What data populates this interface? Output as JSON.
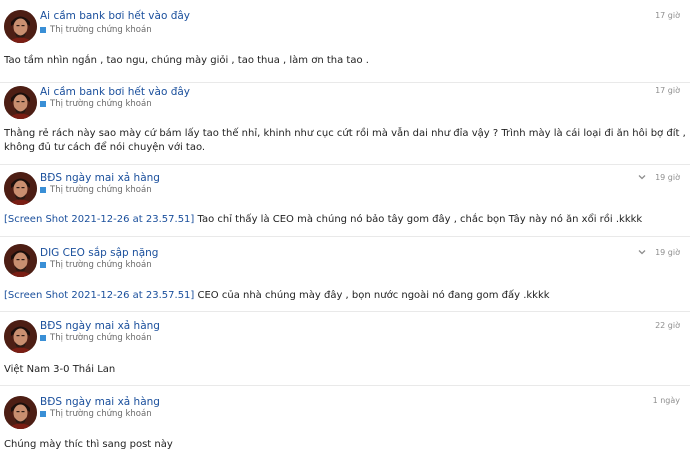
{
  "posts": [
    {
      "username": "Ai cầm bank bơi hết vào đây",
      "category": "Thị trường chứng khoán",
      "time": "17 giờ",
      "expandable": false,
      "link": "",
      "text": "Tao tầm nhìn ngắn , tao ngu, chúng mày giỏi , tao thua , làm ơn tha tao ."
    },
    {
      "username": "Ai cầm bank bơi hết vào đây",
      "category": "Thị trường chứng khoán",
      "time": "17 giờ",
      "expandable": false,
      "link": "",
      "text": "Thằng rẻ rách này sao mày cứ bám lấy tao thế nhỉ, khinh như cục cứt rồi mà vẫn dai như đỉa vậy ? Trình mày là cái loại đi ăn hôi bợ đít , không đủ tư cách để nói chuyện với tao."
    },
    {
      "username": "BĐS ngày mai xả hàng",
      "category": "Thị trường chứng khoán",
      "time": "19 giờ",
      "expandable": true,
      "link": "[Screen Shot 2021-12-26 at 23.57.51]",
      "text": " Tao chỉ thấy là CEO mà chúng nó bảo tây gom đây , chắc bọn Tây này nó ăn xổi rồi .kkkk"
    },
    {
      "username": "DIG CEO sắp sập nặng",
      "category": "Thị trường chứng khoán",
      "time": "19 giờ",
      "expandable": true,
      "link": "[Screen Shot 2021-12-26 at 23.57.51]",
      "text": " CEO của nhà chúng mày đây , bọn nước ngoài nó đang gom đấy .kkkk"
    },
    {
      "username": "BĐS ngày mai xả hàng",
      "category": "Thị trường chứng khoán",
      "time": "22 giờ",
      "expandable": false,
      "link": "",
      "text": "Việt Nam 3-0 Thái Lan"
    },
    {
      "username": "BĐS ngày mai xả hàng",
      "category": "Thị trường chứng khoán",
      "time": "1 ngày",
      "expandable": false,
      "link": "",
      "text": "Chúng mày thíc thì sang post này"
    }
  ],
  "colors": {
    "username": "#1a4f9c",
    "category_square": "#3a8fd6",
    "meta_text": "#8e8e8e",
    "divider": "#e9e9e9"
  },
  "icons": {
    "avatar": "avatar-portrait",
    "expand": "chevron-down-icon",
    "category": "category-square-icon"
  }
}
